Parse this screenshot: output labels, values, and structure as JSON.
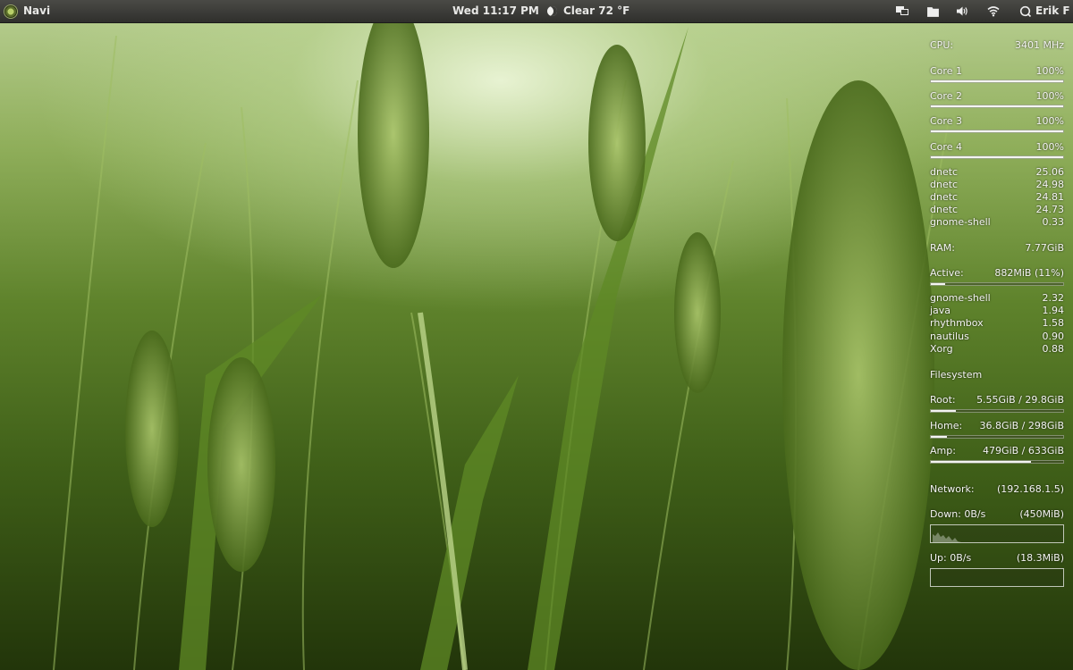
{
  "panel": {
    "app_menu": "Navi",
    "clock": "Wed 11:17 PM",
    "weather": "Clear 72 °F",
    "user": "Erik F"
  },
  "cpu": {
    "label": "CPU:",
    "freq": "3401 MHz",
    "cores": [
      {
        "label": "Core 1",
        "value": "100%",
        "fraction": 1.0
      },
      {
        "label": "Core 2",
        "value": "100%",
        "fraction": 1.0
      },
      {
        "label": "Core 3",
        "value": "100%",
        "fraction": 1.0
      },
      {
        "label": "Core 4",
        "value": "100%",
        "fraction": 1.0
      }
    ],
    "processes": [
      {
        "name": "dnetc",
        "value": "25.06"
      },
      {
        "name": "dnetc",
        "value": "24.98"
      },
      {
        "name": "dnetc",
        "value": "24.81"
      },
      {
        "name": "dnetc",
        "value": "24.73"
      },
      {
        "name": "gnome-shell",
        "value": "0.33"
      }
    ]
  },
  "ram": {
    "label": "RAM:",
    "total": "7.77GiB",
    "active_label": "Active:",
    "active_value": "882MiB (11%)",
    "active_fraction": 0.11,
    "processes": [
      {
        "name": "gnome-shell",
        "value": "2.32"
      },
      {
        "name": "java",
        "value": "1.94"
      },
      {
        "name": "rhythmbox",
        "value": "1.58"
      },
      {
        "name": "nautilus",
        "value": "0.90"
      },
      {
        "name": "Xorg",
        "value": "0.88"
      }
    ]
  },
  "filesystem": {
    "title": "Filesystem",
    "mounts": [
      {
        "label": "Root:",
        "value": "5.55GiB / 29.8GiB",
        "fraction": 0.19
      },
      {
        "label": "Home:",
        "value": "36.8GiB / 298GiB",
        "fraction": 0.12
      },
      {
        "label": "Amp:",
        "value": "479GiB / 633GiB",
        "fraction": 0.76
      }
    ]
  },
  "network": {
    "label": "Network:",
    "ip": "(192.168.1.5)",
    "down_label": "Down: 0B/s",
    "down_total": "(450MiB)",
    "up_label": "Up: 0B/s",
    "up_total": "(18.3MiB)"
  },
  "colors": {
    "panel": "#2f2f2c",
    "text": "#f4f4f2"
  },
  "icons": [
    "distro-logo-icon",
    "moon-icon",
    "display-icon",
    "folder-icon",
    "volume-icon",
    "wifi-icon",
    "user-icon"
  ]
}
